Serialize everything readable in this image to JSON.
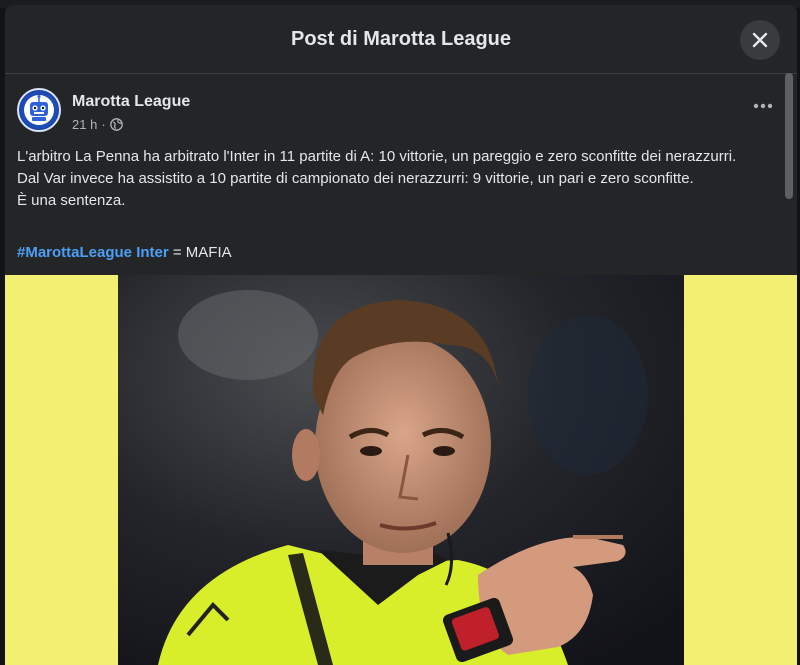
{
  "modal": {
    "title": "Post di Marotta League",
    "close_icon": "close-icon"
  },
  "post": {
    "author": "Marotta League",
    "time": "21 h",
    "separator": "·",
    "audience_icon": "globe-icon",
    "more_icon": "more-horizontal-icon",
    "paragraphs": [
      "L'arbitro La Penna ha arbitrato l'Inter in 11 partite di A: 10 vittorie, un pareggio e zero sconfitte dei nerazzurri.",
      "Dal Var invece ha assistito a 10 partite di campionato dei nerazzurri: 9 vittorie, un pari e zero sconfitte.",
      "È una sentenza."
    ],
    "hashtags": "#MarottaLeague Inter",
    "hashtag_suffix": " = MAFIA",
    "photo_description": "referee-pointing-photo"
  },
  "colors": {
    "modal_bg": "#242526",
    "link": "#4c9ff5",
    "photo_side": "#f3ef72",
    "jersey": "#d8ee2a"
  }
}
